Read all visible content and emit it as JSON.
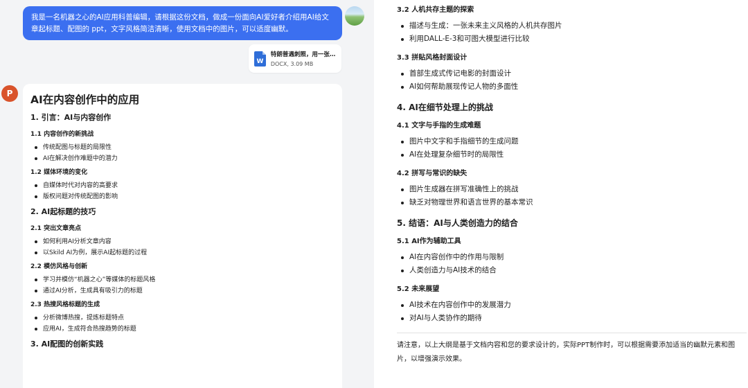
{
  "user_message": {
    "text": "我是一名机器之心的AI应用科普编辑，请根据这份文档，做成一份面向AI爱好者介绍用AI给文章起标题、配图的 ppt，文字风格简洁清晰，使用文档中的图片，可以适度幽默。"
  },
  "attachment": {
    "name": "特朗普遇刺照，用一张2...",
    "meta": "DOCX, 3.09 MB",
    "icon": "docx-file-icon"
  },
  "ai_avatar": {
    "icon": "powerpoint-icon",
    "glyph": "P"
  },
  "doc": {
    "title": "AI在内容创作中的应用",
    "sections": [
      {
        "heading": "1. 引言：AI与内容创作",
        "subsections": [
          {
            "heading": "1.1 内容创作的新挑战",
            "items": [
              "传统配图与标题的局限性",
              "AI在解决创作难题中的潜力"
            ]
          },
          {
            "heading": "1.2 媒体环境的变化",
            "items": [
              "自媒体时代对内容的高要求",
              "版权问题对传统配图的影响"
            ]
          }
        ]
      },
      {
        "heading": "2. AI起标题的技巧",
        "subsections": [
          {
            "heading": "2.1 突出文章亮点",
            "items": [
              "如何利用AI分析文章内容",
              "以Skild AI为例，展示AI起标题的过程"
            ]
          },
          {
            "heading": "2.2 模仿风格与创新",
            "items": [
              "学习并模仿“机器之心”等媒体的标题风格",
              "通过AI分析，生成具有吸引力的标题"
            ]
          },
          {
            "heading": "2.3 热搜风格标题的生成",
            "items": [
              "分析微博热搜，提炼标题特点",
              "应用AI，生成符合热搜趋势的标题"
            ]
          }
        ]
      },
      {
        "heading": "3. AI配图的创新实践",
        "subsections": []
      }
    ]
  },
  "right_doc": {
    "blocks": [
      {
        "heading": "3.2 人机共存主题的探索",
        "level": 3,
        "items": [
          "描述与生成：一张未来主义风格的人机共存图片",
          "利用DALL-E-3和可图大模型进行比较"
        ]
      },
      {
        "heading": "3.3 拼贴风格封面设计",
        "level": 3,
        "items": [
          "首部生成式传记电影的封面设计",
          "AI如何帮助展现传记人物的多面性"
        ]
      },
      {
        "heading": "4. AI在细节处理上的挑战",
        "level": 2,
        "items": []
      },
      {
        "heading": "4.1 文字与手指的生成难题",
        "level": 3,
        "items": [
          "图片中文字和手指细节的生成问题",
          "AI在处理复杂细节时的局限性"
        ]
      },
      {
        "heading": "4.2 拼写与常识的缺失",
        "level": 3,
        "items": [
          "图片生成器在拼写准确性上的挑战",
          "缺乏对物理世界和语言世界的基本常识"
        ]
      },
      {
        "heading": "5. 结语：AI与人类创造力的结合",
        "level": 2,
        "items": []
      },
      {
        "heading": "5.1 AI作为辅助工具",
        "level": 3,
        "items": [
          "AI在内容创作中的作用与限制",
          "人类创造力与AI技术的结合"
        ]
      },
      {
        "heading": "5.2 未来展望",
        "level": 3,
        "items": [
          "AI技术在内容创作中的发展潜力",
          "对AI与人类协作的期待"
        ]
      }
    ],
    "note": "请注意，以上大纲是基于文档内容和您的要求设计的，实际PPT制作时，可以根据需要添加适当的幽默元素和图片，以增强演示效果。"
  },
  "colors": {
    "user_bubble": "#3b6ff0",
    "ai_avatar": "#d9532b",
    "docx_icon": "#2f6ed8"
  }
}
